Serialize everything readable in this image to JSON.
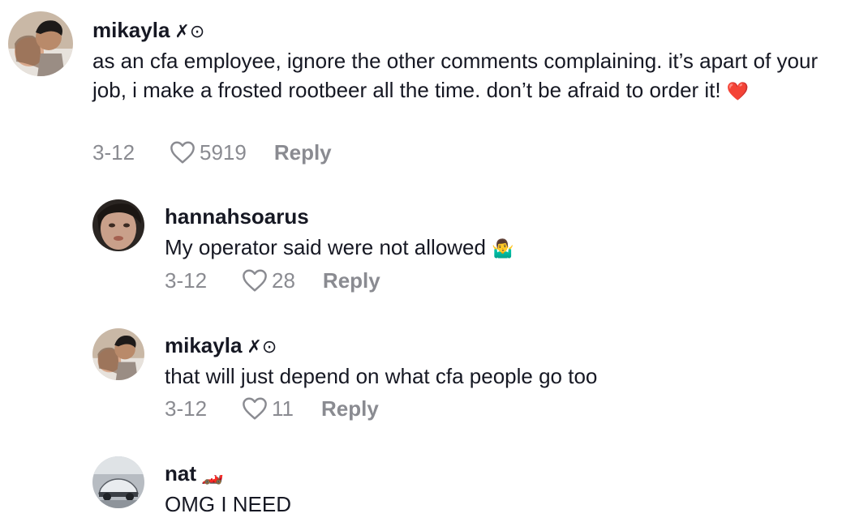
{
  "comments": [
    {
      "username": "mikayla",
      "badge": "✗⊙",
      "text": "as an cfa employee, ignore the other comments complaining. it’s apart of your job, i make a frosted rootbeer all the time. don’t be afraid to order it!",
      "emoji": "❤️",
      "date": "3-12",
      "likes": "5919",
      "reply_label": "Reply"
    },
    {
      "username": "hannahsoarus",
      "text": "My operator said were not allowed",
      "emoji": "🤷‍♂️",
      "date": "3-12",
      "likes": "28",
      "reply_label": "Reply"
    },
    {
      "username": "mikayla",
      "badge": "✗⊙",
      "text": "that will just depend on what cfa people go too",
      "date": "3-12",
      "likes": "11",
      "reply_label": "Reply"
    },
    {
      "username": "nat",
      "badge": "🏎️",
      "text": "OMG I NEED"
    }
  ],
  "colors": {
    "text": "#161823",
    "meta": "#8a8b91",
    "emoji_heart": "#e0245e"
  },
  "icons": {
    "like": "heart-outline-icon"
  }
}
